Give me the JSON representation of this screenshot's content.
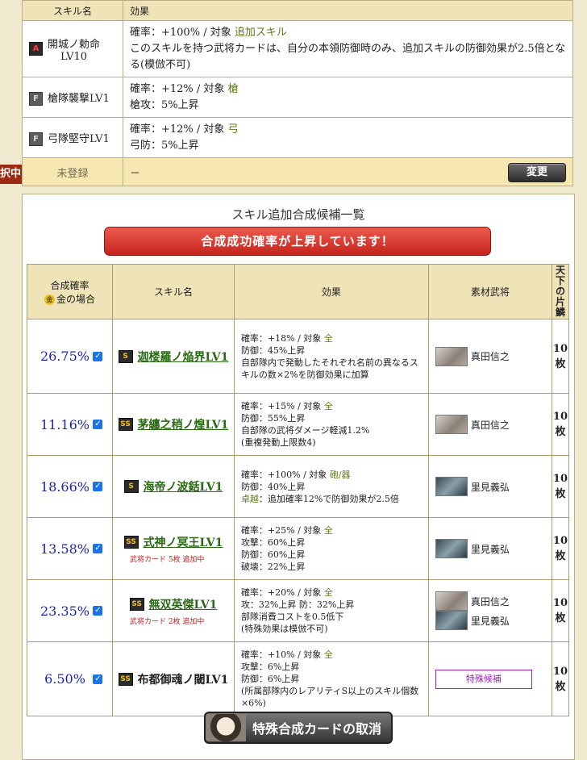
{
  "skills_table": {
    "header_name": "スキル名",
    "header_effect": "効果",
    "rows": [
      {
        "rank": "A",
        "name": "開城ノ勅命",
        "level": "LV10",
        "line1_prefix": "確率：+100%  /  対象",
        "target": "追加スキル",
        "line2": "このスキルを持つ武将カードは、自分の本領防御時のみ、追加スキルの防御効果が2.5倍となる(模倣不可)"
      },
      {
        "rank": "F",
        "name": "槍隊襲撃LV1",
        "line1_prefix": "確率：+12%  /  対象",
        "target": "槍",
        "line2": "槍攻：5%上昇"
      },
      {
        "rank": "F",
        "name": "弓隊堅守LV1",
        "line1_prefix": "確率：+12%  /  対象",
        "target": "弓",
        "line2": "弓防：5%上昇"
      }
    ],
    "unregistered": {
      "tag": "択中",
      "label": "未登録",
      "effect": "－",
      "change_button": "変更"
    }
  },
  "candidates": {
    "title": "スキル追加合成候補一覧",
    "banner": "合成成功確率が上昇しています！",
    "headers": {
      "rate": "合成確率",
      "gold_icon": "金",
      "gold_case": "金の場合",
      "skill": "スキル名",
      "effect": "効果",
      "material": "素材武将",
      "tenka1": "天下の",
      "tenka2": "片鱗"
    },
    "rows": [
      {
        "rate": "26.75%",
        "rank": "S",
        "skill": "迦楼羅ノ焔界LV1",
        "link": true,
        "note": "",
        "effect": [
          "確率：+18%  /  対象  |全",
          "防御：45%上昇",
          "自部隊内で発動したそれぞれ名前の異なるスキルの数×2%を防御効果に加算"
        ],
        "materials": [
          {
            "avatar": "a1",
            "name": "真田信之"
          }
        ],
        "count": "10枚"
      },
      {
        "rate": "11.16%",
        "rank": "SS",
        "skill": "茅纏之稍ノ煌LV1",
        "link": true,
        "note": "",
        "effect": [
          "確率：+15%  /  対象  |全",
          "防御：55%上昇",
          "自部隊の武将ダメージ軽減1.2%",
          "(重複発動上限数4)"
        ],
        "materials": [
          {
            "avatar": "a1",
            "name": "真田信之"
          }
        ],
        "count": "10枚"
      },
      {
        "rate": "18.66%",
        "rank": "S",
        "skill": "海帝ノ波銛LV1",
        "link": true,
        "note": "",
        "effect": [
          "確率：+100%  /  対象  |砲/器",
          "防御：40%上昇",
          "卓越|：追加確率12%で防御効果が2.5倍"
        ],
        "materials": [
          {
            "avatar": "a2",
            "name": "里見義弘"
          }
        ],
        "count": "10枚"
      },
      {
        "rate": "13.58%",
        "rank": "SS",
        "skill": "式神ノ冥王LV1",
        "link": true,
        "note": "武将カード 5枚 追加中",
        "effect": [
          "確率：+25%  /  対象  |全",
          "攻撃：60%上昇",
          "防御：60%上昇",
          "破壊：22%上昇"
        ],
        "materials": [
          {
            "avatar": "a2",
            "name": "里見義弘"
          }
        ],
        "count": "10枚"
      },
      {
        "rate": "23.35%",
        "rank": "SS",
        "skill": "無双英傑LV1",
        "link": true,
        "note": "武将カード 2枚 追加中",
        "effect": [
          "確率：+20%  /  対象  |全",
          "攻：32%上昇  防：32%上昇",
          "部隊消費コストを0.5低下",
          "(特殊効果は模倣不可)"
        ],
        "materials": [
          {
            "avatar": "a1",
            "name": "真田信之"
          },
          {
            "avatar": "a2",
            "name": "里見義弘"
          }
        ],
        "count": "10枚"
      },
      {
        "rate": "6.50%",
        "rank": "SS",
        "skill": "布都御魂ノ閾LV1",
        "link": false,
        "note": "",
        "effect": [
          "確率：+10%  /  対象  |全",
          "攻撃：6%上昇",
          "防御：6%上昇",
          "(所属部隊内のレアリティS以上のスキル個数×6%)"
        ],
        "special": "特殊候補",
        "count": "10枚"
      }
    ],
    "cancel_button": "特殊合成カードの取消"
  }
}
